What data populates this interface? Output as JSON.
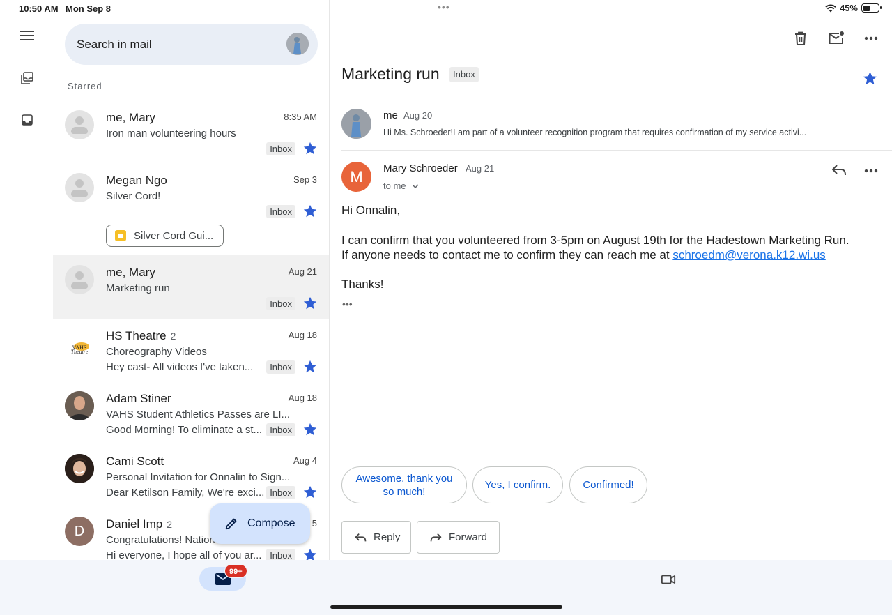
{
  "status_bar": {
    "time": "10:50 AM",
    "date": "Mon Sep 8",
    "battery": "45%",
    "battery_level": 0.45
  },
  "search": {
    "placeholder": "Search in mail"
  },
  "section_label": "Starred",
  "mails": [
    {
      "sender": "me, Mary",
      "count": "",
      "date": "8:35 AM",
      "subject": "Iron man volunteering hours",
      "snippet": "",
      "label": "Inbox",
      "starred": true
    },
    {
      "sender": "Megan Ngo",
      "count": "",
      "date": "Sep 3",
      "subject": "Silver Cord!",
      "snippet": "",
      "label": "Inbox",
      "starred": true,
      "attachment": "Silver Cord Gui..."
    },
    {
      "sender": "me, Mary",
      "count": "",
      "date": "Aug 21",
      "subject": "Marketing run",
      "snippet": "",
      "label": "Inbox",
      "starred": true,
      "selected": true
    },
    {
      "sender": "HS Theatre",
      "count": "2",
      "date": "Aug 18",
      "subject": "Choreography Videos",
      "snippet": "Hey cast- All videos I've taken...",
      "label": "Inbox",
      "starred": true,
      "logo_text": "VAHS Theatre"
    },
    {
      "sender": "Adam Stiner",
      "count": "",
      "date": "Aug 18",
      "subject": "VAHS Student Athletics Passes are LI...",
      "snippet": "Good Morning! To eliminate a st...",
      "label": "Inbox",
      "starred": true
    },
    {
      "sender": "Cami Scott",
      "count": "",
      "date": "Aug 4",
      "subject": "Personal Invitation for Onnalin to Sign...",
      "snippet": "Dear Ketilson Family, We're exci...",
      "label": "Inbox",
      "starred": true
    },
    {
      "sender": "Daniel Imp",
      "count": "2",
      "date": "Jul 15",
      "subject": "Congratulations! Nation",
      "snippet": "Hi everyone, I hope all of you ar...",
      "label": "Inbox",
      "starred": true,
      "initial": "D"
    }
  ],
  "compose": {
    "label": "Compose"
  },
  "bottom_nav": {
    "mail_badge": "99+"
  },
  "detail": {
    "subject": "Marketing run",
    "label": "Inbox",
    "message1": {
      "from": "me",
      "date": "Aug 20",
      "snippet": "Hi Ms. Schroeder!I am part of a volunteer recognition program that requires confirmation of my service activi..."
    },
    "message2": {
      "initial": "M",
      "from": "Mary Schroeder",
      "date": "Aug 21",
      "to": "to me",
      "greeting": "Hi Onnalin,",
      "line1": "I can confirm that you volunteered from 3-5pm on August 19th for the Hadestown Marketing Run.",
      "line2": "If anyone needs to contact me to confirm they can reach me at ",
      "email": "schroedm@verona.k12.wi.us",
      "thanks": "Thanks!",
      "trimmed": "•••"
    },
    "smart_replies": [
      "Awesome, thank you so much!",
      "Yes, I confirm.",
      "Confirmed!"
    ],
    "reply_label": "Reply",
    "forward_label": "Forward"
  },
  "colors": {
    "accent": "#0b57d0",
    "star": "#2f5ed4",
    "avatar_m": "#e8643a",
    "badge": "#d93025"
  }
}
